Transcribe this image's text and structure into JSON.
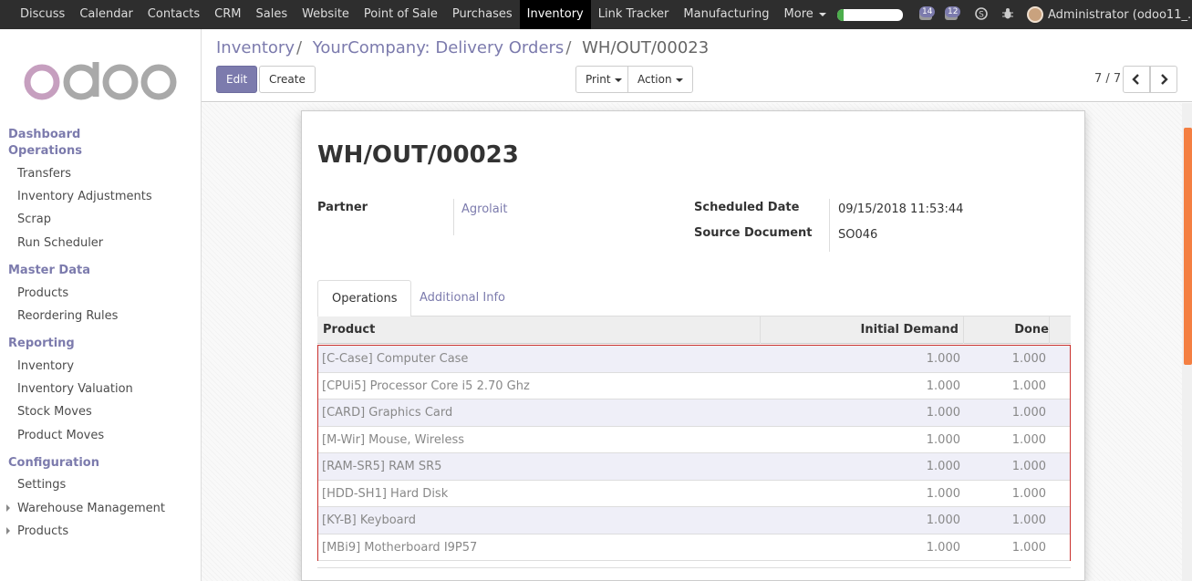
{
  "topbar": {
    "menu": [
      "Discuss",
      "Calendar",
      "Contacts",
      "CRM",
      "Sales",
      "Website",
      "Point of Sale",
      "Purchases",
      "Inventory",
      "Link Tracker",
      "Manufacturing"
    ],
    "more_label": "More",
    "active": "Inventory",
    "progress_fraction": 0.1,
    "messages_count": "14",
    "activities_count": "12",
    "user_label": "Administrator (odoo11_..."
  },
  "sidebar": {
    "logo_text": "odoo",
    "sections": [
      {
        "title": "Dashboard",
        "items": []
      },
      {
        "title": "Operations",
        "items": [
          "Transfers",
          "Inventory Adjustments",
          "Scrap",
          "Run Scheduler"
        ]
      },
      {
        "title": "Master Data",
        "items": [
          "Products",
          "Reordering Rules"
        ]
      },
      {
        "title": "Reporting",
        "items": [
          "Inventory",
          "Inventory Valuation",
          "Stock Moves",
          "Product Moves"
        ]
      },
      {
        "title": "Configuration",
        "items": [
          "Settings",
          "Warehouse Management",
          "Products"
        ]
      }
    ]
  },
  "control_panel": {
    "breadcrumb": [
      "Inventory",
      "YourCompany: Delivery Orders",
      "WH/OUT/00023"
    ],
    "edit_label": "Edit",
    "create_label": "Create",
    "print_label": "Print",
    "action_label": "Action",
    "pager": "7 / 7"
  },
  "form": {
    "title": "WH/OUT/00023",
    "partner_label": "Partner",
    "partner_value": "Agrolait",
    "scheduled_label": "Scheduled Date",
    "scheduled_value": "09/15/2018 11:53:44",
    "source_label": "Source Document",
    "source_value": "SO046",
    "tabs": [
      "Operations",
      "Additional Info"
    ],
    "table": {
      "headers": [
        "Product",
        "Initial Demand",
        "Done"
      ],
      "rows": [
        [
          "[C-Case] Computer Case",
          "1.000",
          "1.000"
        ],
        [
          "[CPUi5] Processor Core i5 2.70 Ghz",
          "1.000",
          "1.000"
        ],
        [
          "[CARD] Graphics Card",
          "1.000",
          "1.000"
        ],
        [
          "[M-Wir] Mouse, Wireless",
          "1.000",
          "1.000"
        ],
        [
          "[RAM-SR5] RAM SR5",
          "1.000",
          "1.000"
        ],
        [
          "[HDD-SH1] Hard Disk",
          "1.000",
          "1.000"
        ],
        [
          "[KY-B] Keyboard",
          "1.000",
          "1.000"
        ],
        [
          "[MBi9] Motherboard I9P57",
          "1.000",
          "1.000"
        ]
      ]
    }
  },
  "colors": {
    "brand": "#7c7bad",
    "navbar": "#2e2e2e",
    "highlight_border": "#c9302c",
    "scrollbar": "#f47f42"
  }
}
